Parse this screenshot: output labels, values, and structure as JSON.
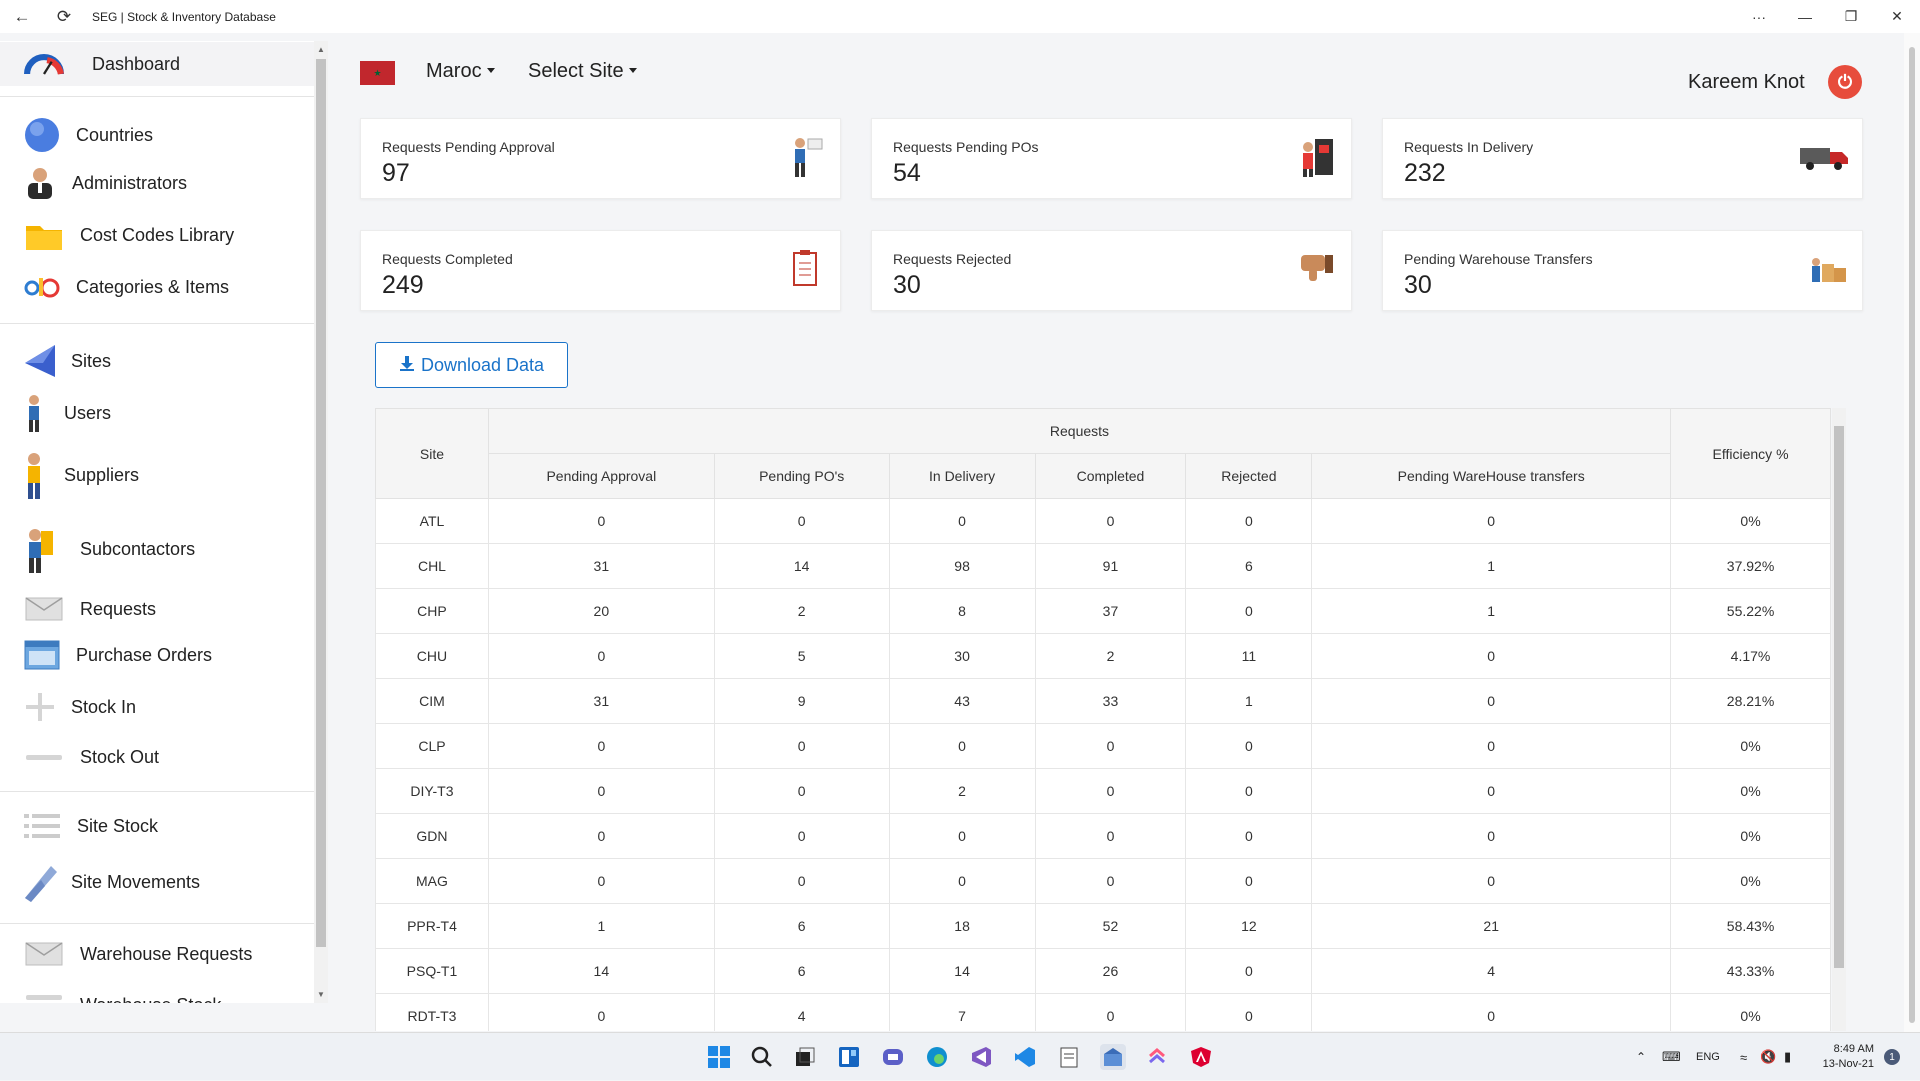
{
  "window": {
    "title": "SEG | Stock & Inventory Database",
    "back_icon": "arrow-left-icon",
    "reload_icon": "reload-icon",
    "more": "···",
    "minimize": "—",
    "restore": "❐",
    "close": "✕"
  },
  "sidebar": {
    "items": [
      {
        "label": "Dashboard",
        "icon": "gauge-icon"
      },
      {
        "label": "Countries",
        "icon": "globe-icon"
      },
      {
        "label": "Administrators",
        "icon": "admin-icon"
      },
      {
        "label": "Cost Codes Library",
        "icon": "folder-icon"
      },
      {
        "label": "Categories & Items",
        "icon": "categories-icon"
      },
      {
        "label": "Sites",
        "icon": "site-flag-icon"
      },
      {
        "label": "Users",
        "icon": "user-icon"
      },
      {
        "label": "Suppliers",
        "icon": "supplier-icon"
      },
      {
        "label": "Subcontactors",
        "icon": "subcontractor-icon"
      },
      {
        "label": "Requests",
        "icon": "envelope-icon"
      },
      {
        "label": "Purchase Orders",
        "icon": "window-icon"
      },
      {
        "label": "Stock In",
        "icon": "plus-icon"
      },
      {
        "label": "Stock Out",
        "icon": "minus-icon"
      },
      {
        "label": "Site Stock",
        "icon": "list-icon"
      },
      {
        "label": "Site Movements",
        "icon": "movement-icon"
      },
      {
        "label": "Warehouse Requests",
        "icon": "envelope-icon"
      },
      {
        "label": "Warehouse Stock",
        "icon": "minus-icon"
      }
    ]
  },
  "header": {
    "country": "Maroc",
    "site_select": "Select Site",
    "user_name": "Kareem Knot",
    "power_icon": "power-icon"
  },
  "cards": [
    {
      "label": "Requests Pending Approval",
      "value": "97",
      "icon": "approval-person-icon"
    },
    {
      "label": "Requests Pending POs",
      "value": "54",
      "icon": "purchase-order-icon"
    },
    {
      "label": "Requests In Delivery",
      "value": "232",
      "icon": "truck-icon"
    },
    {
      "label": "Requests Completed",
      "value": "249",
      "icon": "clipboard-icon"
    },
    {
      "label": "Requests Rejected",
      "value": "30",
      "icon": "thumbs-down-icon"
    },
    {
      "label": "Pending Warehouse Transfers",
      "value": "30",
      "icon": "boxes-icon"
    }
  ],
  "download_label": "Download Data",
  "table": {
    "site_header": "Site",
    "group_header": "Requests",
    "efficiency_header": "Efficiency %",
    "columns": [
      "Pending Approval",
      "Pending PO's",
      "In Delivery",
      "Completed",
      "Rejected",
      "Pending WareHouse transfers"
    ],
    "rows": [
      [
        "ATL",
        "0",
        "0",
        "0",
        "0",
        "0",
        "0",
        "0%"
      ],
      [
        "CHL",
        "31",
        "14",
        "98",
        "91",
        "6",
        "1",
        "37.92%"
      ],
      [
        "CHP",
        "20",
        "2",
        "8",
        "37",
        "0",
        "1",
        "55.22%"
      ],
      [
        "CHU",
        "0",
        "5",
        "30",
        "2",
        "11",
        "0",
        "4.17%"
      ],
      [
        "CIM",
        "31",
        "9",
        "43",
        "33",
        "1",
        "0",
        "28.21%"
      ],
      [
        "CLP",
        "0",
        "0",
        "0",
        "0",
        "0",
        "0",
        "0%"
      ],
      [
        "DIY-T3",
        "0",
        "0",
        "2",
        "0",
        "0",
        "0",
        "0%"
      ],
      [
        "GDN",
        "0",
        "0",
        "0",
        "0",
        "0",
        "0",
        "0%"
      ],
      [
        "MAG",
        "0",
        "0",
        "0",
        "0",
        "0",
        "0",
        "0%"
      ],
      [
        "PPR-T4",
        "1",
        "6",
        "18",
        "52",
        "12",
        "21",
        "58.43%"
      ],
      [
        "PSQ-T1",
        "14",
        "6",
        "14",
        "26",
        "0",
        "4",
        "43.33%"
      ],
      [
        "RDT-T3",
        "0",
        "4",
        "7",
        "0",
        "0",
        "0",
        "0%"
      ]
    ]
  },
  "taskbar": {
    "language": "ENG",
    "time": "8:49 AM",
    "date": "13-Nov-21",
    "notification_count": "1"
  }
}
